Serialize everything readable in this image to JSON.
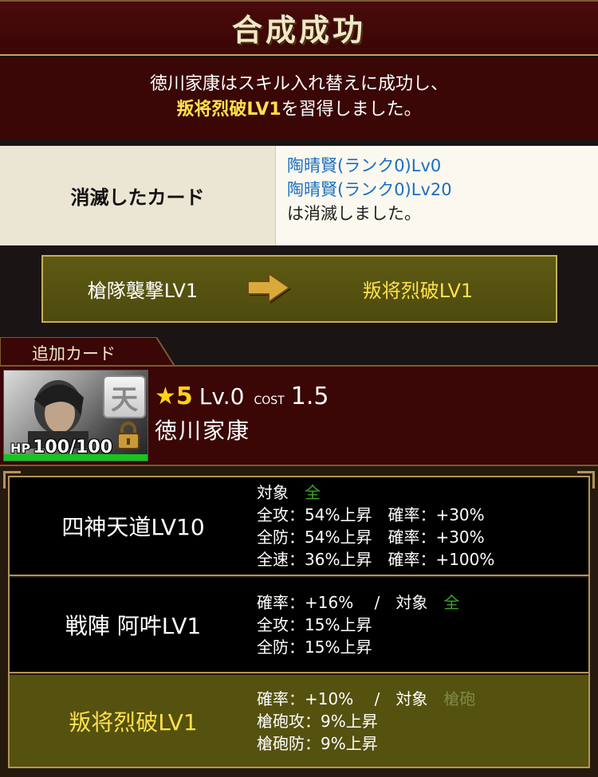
{
  "header": {
    "title": "合成成功"
  },
  "message": {
    "line1": "徳川家康はスキル入れ替えに成功し、",
    "line2_skill": "叛将烈破LV1",
    "line2_rest": "を習得しました。"
  },
  "destroyed": {
    "label": "消滅したカード",
    "cards": [
      "陶晴賢(ランク0)Lv0",
      "陶晴賢(ランク0)Lv20"
    ],
    "suffix": "は消滅しました。"
  },
  "skill_change": {
    "from": "槍隊襲撃LV1",
    "to": "叛将烈破LV1"
  },
  "added": {
    "tab_label": "追加カード",
    "rank_char": "天",
    "hp_label": "HP",
    "hp_value": "100/100",
    "star_symbol": "★",
    "stars": "5",
    "level": "Lv.0",
    "cost_label": "COST",
    "cost": "1.5",
    "name": "徳川家康"
  },
  "skills": [
    {
      "name": "四神天道LV10",
      "target_label": "対象",
      "target_value": "全",
      "lines": [
        "全攻：54%上昇　確率：+30%",
        "全防：54%上昇　確率：+30%",
        "全速：36%上昇　確率：+100%"
      ]
    },
    {
      "name": "戦陣 阿吽LV1",
      "rate": "確率：+16%",
      "target_label": "対象",
      "target_value": "全",
      "lines": [
        "全攻：15%上昇",
        "全防：15%上昇"
      ]
    },
    {
      "name": "叛将烈破LV1",
      "rate": "確率：+10%",
      "target_label": "対象",
      "target_value": "槍砲",
      "lines": [
        "槍砲攻：9%上昇",
        "槍砲防：9%上昇"
      ]
    }
  ],
  "colors": {
    "accent_yellow": "#ffe14a",
    "link_blue": "#1a6ec2",
    "target_green": "#3fa22a",
    "hp_green": "#16c51d"
  }
}
